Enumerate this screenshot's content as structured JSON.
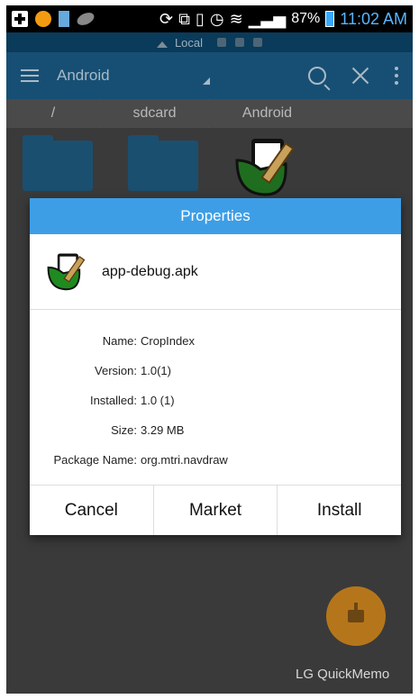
{
  "status_bar": {
    "battery_percent": "87%",
    "time": "11:02 AM"
  },
  "location_bar": {
    "label": "Local"
  },
  "toolbar": {
    "title": "Android"
  },
  "breadcrumb": [
    "/",
    "sdcard",
    "Android"
  ],
  "dialog": {
    "title": "Properties",
    "filename": "app-debug.apk",
    "properties": [
      {
        "key": "Name:",
        "value": "CropIndex"
      },
      {
        "key": "Version:",
        "value": "1.0(1)"
      },
      {
        "key": "Installed:",
        "value": "1.0 (1)"
      },
      {
        "key": "Size:",
        "value": "3.29 MB"
      },
      {
        "key": "Package Name:",
        "value": "org.mtri.navdraw"
      }
    ],
    "buttons": {
      "cancel": "Cancel",
      "market": "Market",
      "install": "Install"
    }
  },
  "quickmemo_label": "LG QuickMemo",
  "colors": {
    "dialog_title_bg": "#3d9ee6",
    "fab": "#b5761b",
    "time": "#58b6ff"
  }
}
